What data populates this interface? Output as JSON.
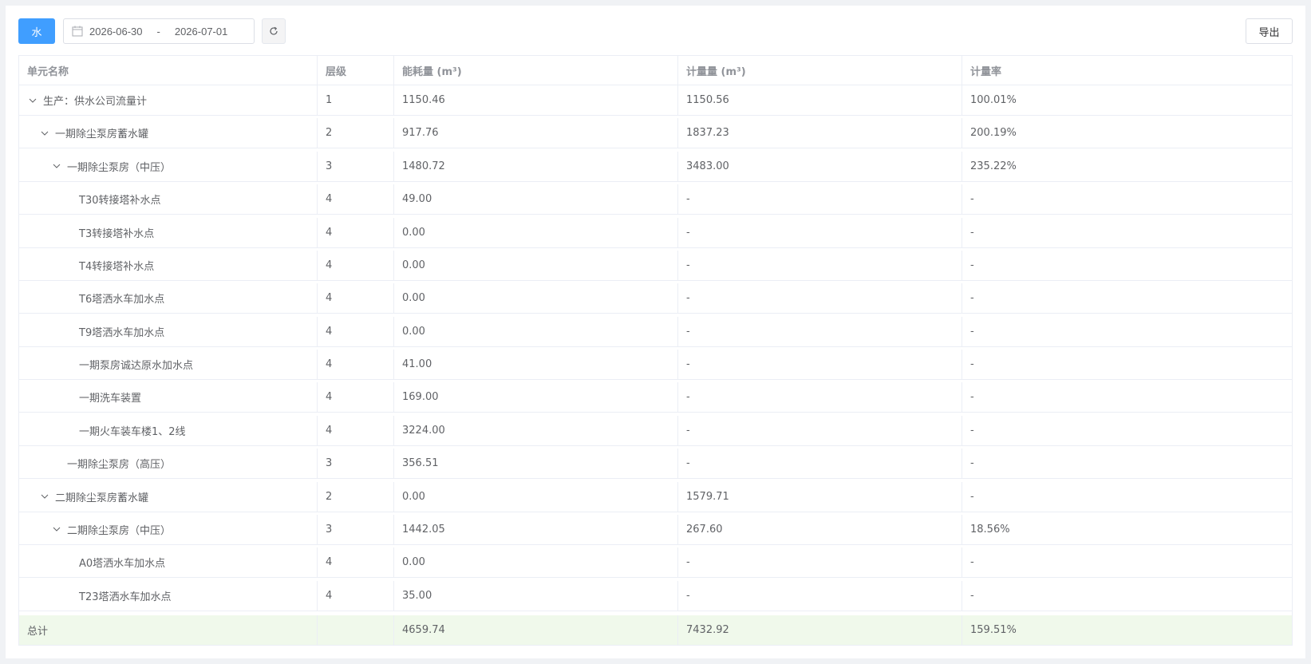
{
  "toolbar": {
    "water_label": "水",
    "date_start": "2026-06-30",
    "date_sep": "-",
    "date_end": "2026-07-01",
    "export_label": "导出"
  },
  "table": {
    "columns": [
      "单元名称",
      "层级",
      "能耗量 (m³)",
      "计量量 (m³)",
      "计量率"
    ],
    "rows": [
      {
        "name": "生产：供水公司流量计",
        "level": "1",
        "energy": "1150.46",
        "metered": "1150.56",
        "rate": "100.01%",
        "depth": 0,
        "expandable": true
      },
      {
        "name": "一期除尘泵房蓄水罐",
        "level": "2",
        "energy": "917.76",
        "metered": "1837.23",
        "rate": "200.19%",
        "depth": 1,
        "expandable": true
      },
      {
        "name": "一期除尘泵房（中压）",
        "level": "3",
        "energy": "1480.72",
        "metered": "3483.00",
        "rate": "235.22%",
        "depth": 2,
        "expandable": true
      },
      {
        "name": "T30转接塔补水点",
        "level": "4",
        "energy": "49.00",
        "metered": "-",
        "rate": "-",
        "depth": 3,
        "expandable": false
      },
      {
        "name": "T3转接塔补水点",
        "level": "4",
        "energy": "0.00",
        "metered": "-",
        "rate": "-",
        "depth": 3,
        "expandable": false
      },
      {
        "name": "T4转接塔补水点",
        "level": "4",
        "energy": "0.00",
        "metered": "-",
        "rate": "-",
        "depth": 3,
        "expandable": false
      },
      {
        "name": "T6塔洒水车加水点",
        "level": "4",
        "energy": "0.00",
        "metered": "-",
        "rate": "-",
        "depth": 3,
        "expandable": false
      },
      {
        "name": "T9塔洒水车加水点",
        "level": "4",
        "energy": "0.00",
        "metered": "-",
        "rate": "-",
        "depth": 3,
        "expandable": false
      },
      {
        "name": "一期泵房诚达原水加水点",
        "level": "4",
        "energy": "41.00",
        "metered": "-",
        "rate": "-",
        "depth": 3,
        "expandable": false
      },
      {
        "name": "一期洗车装置",
        "level": "4",
        "energy": "169.00",
        "metered": "-",
        "rate": "-",
        "depth": 3,
        "expandable": false
      },
      {
        "name": "一期火车装车楼1、2线",
        "level": "4",
        "energy": "3224.00",
        "metered": "-",
        "rate": "-",
        "depth": 3,
        "expandable": false
      },
      {
        "name": "一期除尘泵房（高压）",
        "level": "3",
        "energy": "356.51",
        "metered": "-",
        "rate": "-",
        "depth": 2,
        "expandable": false
      },
      {
        "name": "二期除尘泵房蓄水罐",
        "level": "2",
        "energy": "0.00",
        "metered": "1579.71",
        "rate": "-",
        "depth": 1,
        "expandable": true
      },
      {
        "name": "二期除尘泵房（中压）",
        "level": "3",
        "energy": "1442.05",
        "metered": "267.60",
        "rate": "18.56%",
        "depth": 2,
        "expandable": true
      },
      {
        "name": "A0塔洒水车加水点",
        "level": "4",
        "energy": "0.00",
        "metered": "-",
        "rate": "-",
        "depth": 3,
        "expandable": false
      },
      {
        "name": "T23塔洒水车加水点",
        "level": "4",
        "energy": "35.00",
        "metered": "-",
        "rate": "-",
        "depth": 3,
        "expandable": false
      }
    ],
    "total": {
      "label": "总计",
      "level": "",
      "energy": "4659.74",
      "metered": "7432.92",
      "rate": "159.51%"
    }
  }
}
